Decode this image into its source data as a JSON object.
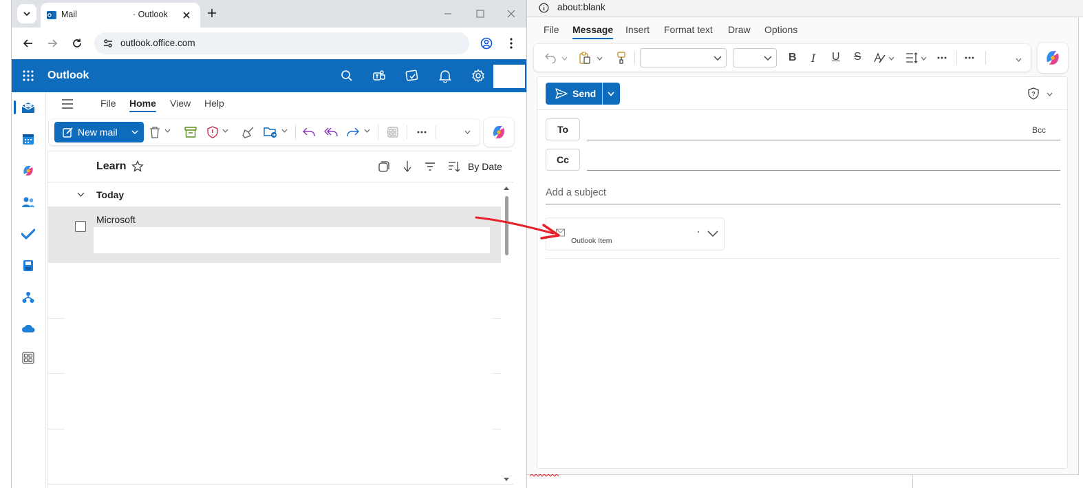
{
  "browser": {
    "tab_title": "Mail",
    "tab_title_suffix": "· Outlook",
    "url": "outlook.office.com"
  },
  "owa": {
    "brand": "Outlook",
    "ribbon_tabs": [
      "File",
      "Home",
      "View",
      "Help"
    ],
    "selected_ribbon_tab": "Home",
    "new_mail_label": "New mail",
    "folder_name": "Learn",
    "sort_label": "By Date",
    "group_label": "Today",
    "messages": [
      {
        "sender": "Microsoft",
        "preview": ""
      }
    ]
  },
  "popup": {
    "window_title": "about:blank",
    "tabs": [
      "File",
      "Message",
      "Insert",
      "Format text",
      "Draw",
      "Options"
    ],
    "selected_tab": "Message",
    "send_label": "Send",
    "to_label": "To",
    "cc_label": "Cc",
    "bcc_label": "Bcc",
    "subject_placeholder": "Add a subject",
    "attachment_name": "Outlook Item"
  },
  "colors": {
    "brand_blue": "#0f6cbd",
    "annotation_arrow": "#e8212b"
  }
}
